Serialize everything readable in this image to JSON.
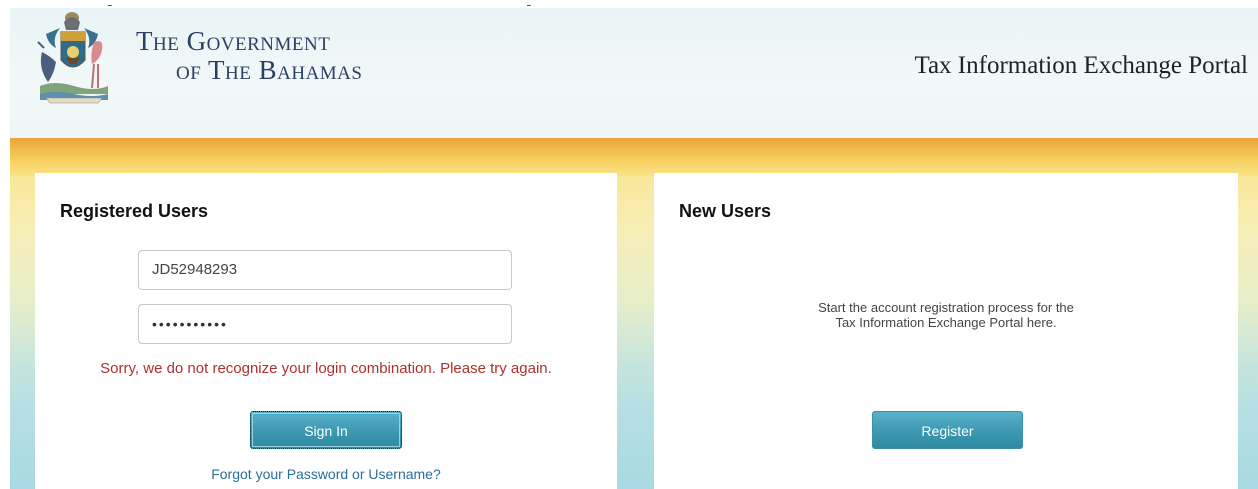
{
  "header": {
    "gov_title_line1": "The Government",
    "gov_title_line2": "of The Bahamas",
    "portal_title": "Tax Information Exchange Portal"
  },
  "registered_users": {
    "heading": "Registered Users",
    "username_value": "JD52948293",
    "password_value": "•••••••••••",
    "error_message": "Sorry, we do not recognize your login combination. Please try again.",
    "sign_in_label": "Sign In",
    "forgot_link": "Forgot your Password or Username?"
  },
  "new_users": {
    "heading": "New Users",
    "description_line1": "Start the account registration process for the",
    "description_line2": "Tax Information Exchange Portal here.",
    "register_label": "Register"
  },
  "colors": {
    "accent_button": "#3d9ab3",
    "error_text": "#b03030",
    "link": "#2a6e9a",
    "gold_band": "#f0b847"
  },
  "icons": {
    "crest": "coat-of-arms-icon"
  }
}
